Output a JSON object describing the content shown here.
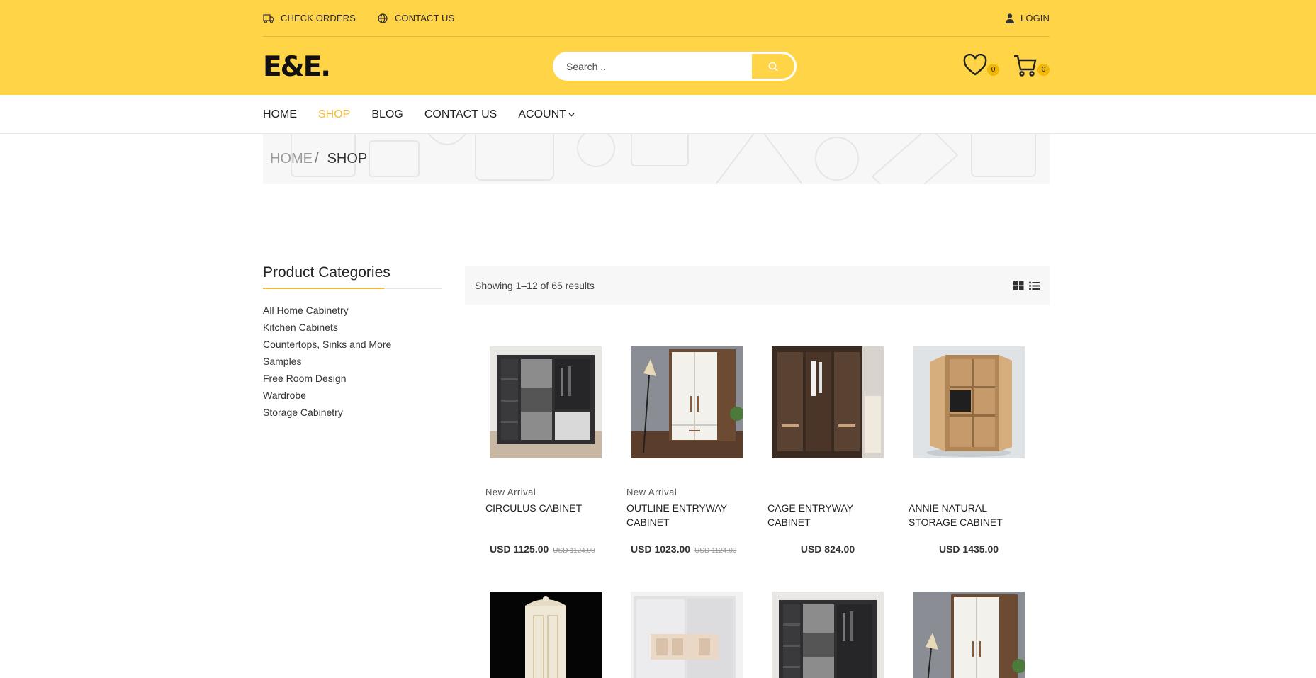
{
  "topbar": {
    "check_orders": "CHECK ORDERS",
    "contact_us": "CONTACT US",
    "login": "LOGIN"
  },
  "header": {
    "logo": "E&E.",
    "search_placeholder": "Search ..",
    "wishlist_count": "0",
    "cart_count": "0"
  },
  "nav": {
    "items": [
      {
        "label": "HOME",
        "active": false
      },
      {
        "label": "SHOP",
        "active": true
      },
      {
        "label": "BLOG",
        "active": false
      },
      {
        "label": "CONTACT US",
        "active": false
      },
      {
        "label": "ACOUNT",
        "active": false
      }
    ]
  },
  "breadcrumb": {
    "home": "HOME",
    "separator": "/",
    "current": "SHOP"
  },
  "sidebar": {
    "title": "Product Categories",
    "categories": [
      "All Home Cabinetry",
      "Kitchen Cabinets",
      "Countertops, Sinks and More",
      "Samples",
      "Free Room Design",
      "Wardrobe",
      "Storage Cabinetry"
    ]
  },
  "toolbar": {
    "results": "Showing 1–12 of 65 results"
  },
  "products": [
    {
      "tag": "New Arrival",
      "name": "CIRCULUS CABINET",
      "price": "USD 1125.00",
      "old_price": "USD 1124.00"
    },
    {
      "tag": "New Arrival",
      "name": "OUTLINE ENTRYWAY CABINET",
      "price": "USD 1023.00",
      "old_price": "USD 1124.00"
    },
    {
      "tag": "",
      "name": "CAGE ENTRYWAY CABINET",
      "price": "USD 824.00",
      "old_price": ""
    },
    {
      "tag": "",
      "name": "ANNIE NATURAL STORAGE CABINET",
      "price": "USD 1435.00",
      "old_price": ""
    }
  ],
  "colors": {
    "brand_yellow": "#ffd447",
    "accent": "#f2b93b",
    "badge": "#f2b705"
  }
}
